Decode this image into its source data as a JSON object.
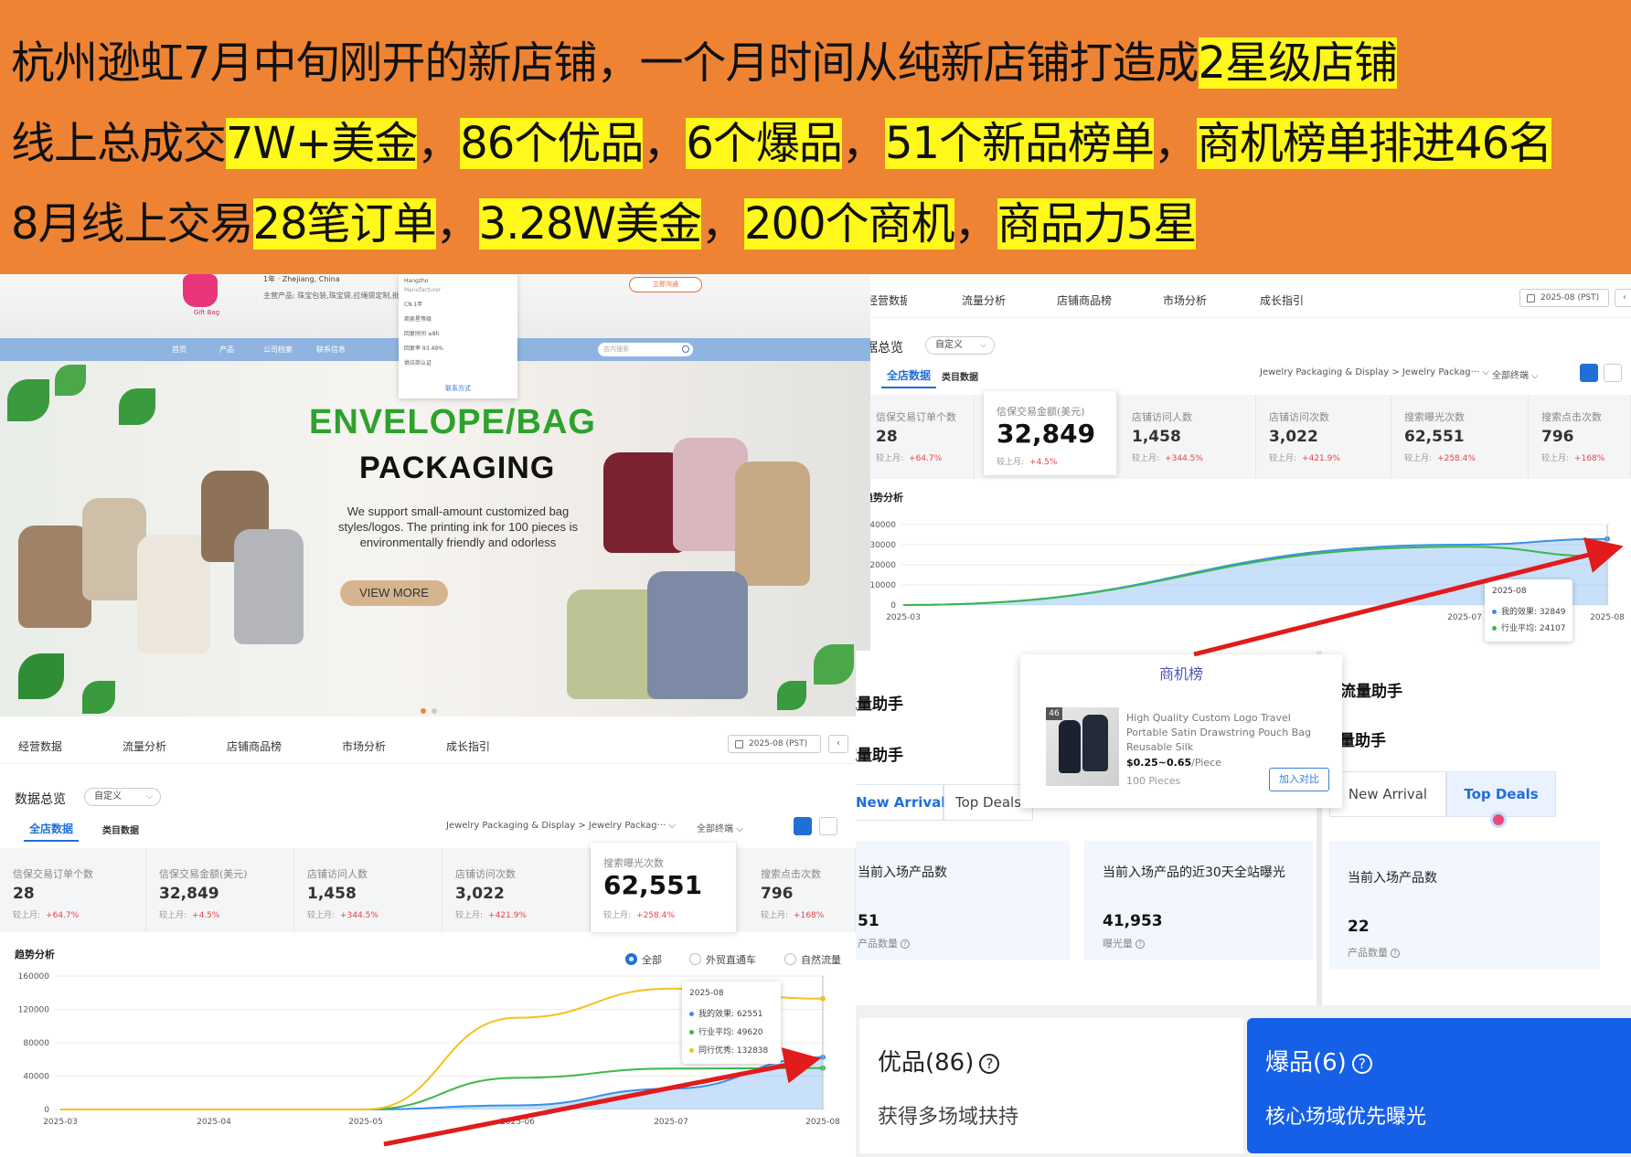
{
  "banner": {
    "line1": {
      "plain": "杭州逊虹7月中旬刚开的新店铺，一个月时间从纯新店铺打造成",
      "hl": "2星级店铺"
    },
    "line2": [
      {
        "t": "线上总成交",
        "hl": false
      },
      {
        "t": "7W+美金",
        "hl": true
      },
      {
        "t": "，",
        "hl": false
      },
      {
        "t": "86个优品",
        "hl": true
      },
      {
        "t": "，",
        "hl": false
      },
      {
        "t": "6个爆品",
        "hl": true
      },
      {
        "t": "，",
        "hl": false
      },
      {
        "t": "51个新品榜单",
        "hl": true
      },
      {
        "t": "，",
        "hl": false
      },
      {
        "t": "商机榜单排进46名",
        "hl": true
      }
    ],
    "line3": [
      {
        "t": "8月线上交易",
        "hl": false
      },
      {
        "t": "28笔订单",
        "hl": true
      },
      {
        "t": "，",
        "hl": false
      },
      {
        "t": "3.28W美金",
        "hl": true
      },
      {
        "t": "，",
        "hl": false
      },
      {
        "t": "200个商机",
        "hl": true
      },
      {
        "t": "，",
        "hl": false
      },
      {
        "t": "商品力5星",
        "hl": true
      }
    ]
  },
  "store": {
    "logo_text": "Gift Bag",
    "years": "1年",
    "location": "Zhejiang, China",
    "main_products": "主营产品: 珠宝包装,珠宝袋,拉绳袋定制,批发信封",
    "contact_button": "立即沟通",
    "nav": [
      "首页",
      "产品",
      "公司档案",
      "联系信息"
    ],
    "search_placeholder": "店内搜索",
    "popup": {
      "rows": [
        "Hangzho",
        "Manufacturer",
        "CN   1年",
        "商家星等级",
        "回复时间     ≤8h",
        "回复率     93.49%",
        "供应商认证"
      ],
      "link": "联系方式"
    },
    "hero": {
      "title1": "ENVELOPE/BAG",
      "title2": "PACKAGING",
      "desc": "We support small-amount customized bag styles/logos. The printing ink for 100 pieces is environmentally friendly and odorless",
      "button": "VIEW MORE"
    }
  },
  "dash_left": {
    "tabs": [
      "经营数据",
      "流量分析",
      "店铺商品榜",
      "市场分析",
      "成长指引"
    ],
    "date": "2025-08 (PST)",
    "overview_title": "数据总览",
    "overview_select": "自定义",
    "subtab_all": "全店数据",
    "subtab_cat": "类目数据",
    "category_filter": "Jewelry Packaging & Display > Jewelry Packag···",
    "terminal_filter": "全部终端",
    "metrics": [
      {
        "label": "信保交易订单个数",
        "value": "28",
        "comp": "较上月:",
        "delta": "+64.7%"
      },
      {
        "label": "信保交易金额(美元)",
        "value": "32,849",
        "comp": "较上月:",
        "delta": "+4.5%"
      },
      {
        "label": "店铺访问人数",
        "value": "1,458",
        "comp": "较上月:",
        "delta": "+344.5%"
      },
      {
        "label": "店铺访问次数",
        "value": "3,022",
        "comp": "较上月:",
        "delta": "+421.9%"
      },
      {
        "label": "搜索曝光次数",
        "value": "62,551",
        "comp": "较上月:",
        "delta": "+258.4%"
      },
      {
        "label": "搜索点击次数",
        "value": "796",
        "comp": "较上月:",
        "delta": "+168%"
      }
    ],
    "trend_title": "趋势分析",
    "radios": [
      "全部",
      "外贸直通车",
      "自然流量"
    ],
    "tooltip": {
      "title": "2025-08",
      "rows": [
        "我的效果: 62551",
        "行业平均: 49620",
        "同行优秀: 132838"
      ]
    },
    "legend": [
      "我的效果",
      "行业平均",
      "同行优秀"
    ]
  },
  "dash_right": {
    "tabs": [
      "经营数据",
      "流量分析",
      "店铺商品榜",
      "市场分析",
      "成长指引"
    ],
    "date": "2025-08 (PST)",
    "overview_title": "数据总览",
    "overview_select": "自定义",
    "subtab_all": "全店数据",
    "subtab_cat": "类目数据",
    "category_filter": "Jewelry Packaging & Display > Jewelry Packag···",
    "terminal_filter": "全部终端",
    "metrics": [
      {
        "label": "信保交易订单个数",
        "value": "28",
        "comp": "较上月:",
        "delta": "+64.7%"
      },
      {
        "label": "信保交易金额(美元)",
        "value": "32,849",
        "comp": "较上月:",
        "delta": "+4.5%"
      },
      {
        "label": "店铺访问人数",
        "value": "1,458",
        "comp": "较上月:",
        "delta": "+344.5%"
      },
      {
        "label": "店铺访问次数",
        "value": "3,022",
        "comp": "较上月:",
        "delta": "+421.9%"
      },
      {
        "label": "搜索曝光次数",
        "value": "62,551",
        "comp": "较上月:",
        "delta": "+258.4%"
      },
      {
        "label": "搜索点击次数",
        "value": "796",
        "comp": "较上月:",
        "delta": "+168%"
      }
    ],
    "trend_title": "趋势分析",
    "tooltip": {
      "title": "2025-08",
      "rows": [
        "我的效果: 32849",
        "行业平均: 24107"
      ]
    }
  },
  "opportunity": {
    "title": "商机榜",
    "rank": "46",
    "product_title": "High Quality Custom Logo Travel Portable Satin Drawstring Pouch Bag Reusable Silk",
    "price": "$0.25~0.65",
    "unit": "/Piece",
    "moq": "100 Pieces",
    "compare_button": "加入对比"
  },
  "traffic_left": {
    "title": "流量助手",
    "tab_new": "New Arrival",
    "tab_top": "Top Deals",
    "card1": {
      "title": "当前入场产品数",
      "value": "51",
      "sub": "产品数量"
    },
    "card2": {
      "title": "当前入场产品的近30天全站曝光",
      "value": "41,953",
      "sub": "曝光量"
    }
  },
  "traffic_right": {
    "title": "流量助手",
    "tab_new": "New Arrival",
    "tab_top": "Top Deals",
    "card1": {
      "title": "当前入场产品数",
      "value": "22",
      "sub": "产品数量"
    }
  },
  "quality": {
    "good_label": "优品(86)",
    "good_sub": "获得多场域扶持",
    "hot_label": "爆品(6)",
    "hot_sub": "核心场域优先曝光"
  },
  "colors": {
    "banner": "#ee8333",
    "highlight": "#fff81a",
    "primary": "#1f6fd8",
    "my_series": "#3a8fe8",
    "industry_series": "#3cb84a",
    "peer_series": "#f2c21b",
    "arrow": "#e21b1b",
    "hot_bg": "#1660e8"
  },
  "chart_data": [
    {
      "type": "area",
      "title": "趋势分析",
      "x": [
        "2025-03",
        "2025-04",
        "2025-05",
        "2025-06",
        "2025-07",
        "2025-08"
      ],
      "ylim": [
        0,
        160000
      ],
      "yticks": [
        0,
        40000,
        80000,
        120000,
        160000
      ],
      "series": [
        {
          "name": "我的效果",
          "values": [
            0,
            0,
            0,
            5000,
            25000,
            62551
          ]
        },
        {
          "name": "行业平均",
          "values": [
            0,
            0,
            0,
            38000,
            49000,
            49620
          ]
        },
        {
          "name": "同行优秀",
          "values": [
            0,
            0,
            0,
            110000,
            145000,
            132838
          ]
        }
      ]
    },
    {
      "type": "area",
      "title": "趋势分析",
      "x": [
        "2025-03",
        "2025-07",
        "2025-08"
      ],
      "ylim": [
        0,
        40000
      ],
      "yticks": [
        0,
        10000,
        20000,
        30000,
        40000
      ],
      "series": [
        {
          "name": "我的效果",
          "values": [
            0,
            30000,
            32849
          ]
        },
        {
          "name": "行业平均",
          "values": [
            0,
            29000,
            24107
          ]
        }
      ]
    }
  ]
}
